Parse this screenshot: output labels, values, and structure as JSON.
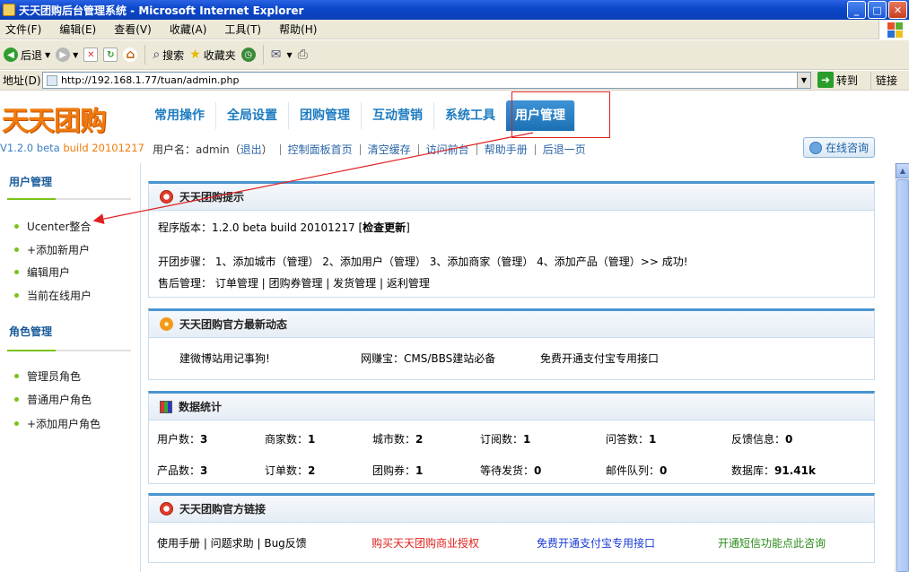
{
  "window": {
    "title": "天天团购后台管理系统 - Microsoft Internet Explorer",
    "min": "_",
    "max": "□",
    "close": "✕"
  },
  "menu": [
    "文件(F)",
    "编辑(E)",
    "查看(V)",
    "收藏(A)",
    "工具(T)",
    "帮助(H)"
  ],
  "toolbar": {
    "back": "后退",
    "search": "搜索",
    "favorites": "收藏夹"
  },
  "address": {
    "label": "地址(D)",
    "url": "http://192.168.1.77/tuan/admin.php",
    "go": "转到",
    "links": "链接"
  },
  "app": {
    "logo": "天天团购",
    "version_prefix": "V1.2.0 beta",
    "version_build": " build 20101217",
    "tabs": [
      "常用操作",
      "全局设置",
      "团购管理",
      "互动营销",
      "系统工具",
      "用户管理"
    ],
    "active_tab": "用户管理",
    "subnav": {
      "user_label": "用户名：admin（",
      "logout": "退出",
      "user_close": "）",
      "items": [
        "控制面板首页",
        "清空缓存",
        "访问前台",
        "帮助手册",
        "后退一页"
      ]
    },
    "online_consult": "在线咨询"
  },
  "sidebar": {
    "sections": [
      {
        "title": "用户管理",
        "items": [
          "Ucenter整合",
          "+添加新用户",
          "编辑用户",
          "当前在线用户"
        ]
      },
      {
        "title": "角色管理",
        "items": [
          "管理员角色",
          "普通用户角色",
          "+添加用户角色"
        ]
      }
    ]
  },
  "panels": {
    "tips": {
      "title": "天天团购提示",
      "version_line": "程序版本：1.2.0 beta build 20101217",
      "check_update": "检查更新",
      "steps": "开团步骤：  1、添加城市（管理） 2、添加用户（管理） 3、添加商家（管理） 4、添加产品（管理）>> 成功!",
      "after_sale": "售后管理：  订单管理 |  团购券管理 |  发货管理 |  返利管理"
    },
    "news": {
      "title": "天天团购官方最新动态",
      "items": [
        "建微博站用记事狗!",
        "网赚宝：CMS/BBS建站必备",
        "免费开通支付宝专用接口"
      ]
    },
    "stats": {
      "title": "数据统计",
      "row1": [
        {
          "label": "用户数：",
          "value": "3"
        },
        {
          "label": "商家数：",
          "value": "1"
        },
        {
          "label": "城市数：",
          "value": "2"
        },
        {
          "label": "订阅数：",
          "value": "1"
        },
        {
          "label": "问答数：",
          "value": "1"
        },
        {
          "label": "反馈信息：",
          "value": "0"
        }
      ],
      "row2": [
        {
          "label": "产品数：",
          "value": "3"
        },
        {
          "label": "订单数：",
          "value": "2"
        },
        {
          "label": "团购券：",
          "value": "1"
        },
        {
          "label": "等待发货：",
          "value": "0"
        },
        {
          "label": "邮件队列：",
          "value": "0"
        },
        {
          "label": "数据库：",
          "value": "91.41k"
        }
      ]
    },
    "links": {
      "title": "天天团购官方链接",
      "items": [
        "使用手册 | 问题求助 | Bug反馈",
        "购买天天团购商业授权",
        "免费开通支付宝专用接口",
        "开通短信功能点此咨询"
      ]
    }
  },
  "colors": {
    "brand_orange": "#f07a0c",
    "nav_blue": "#1d7bc0",
    "accent_green": "#7ac21a",
    "annotation_red": "#e02020"
  }
}
